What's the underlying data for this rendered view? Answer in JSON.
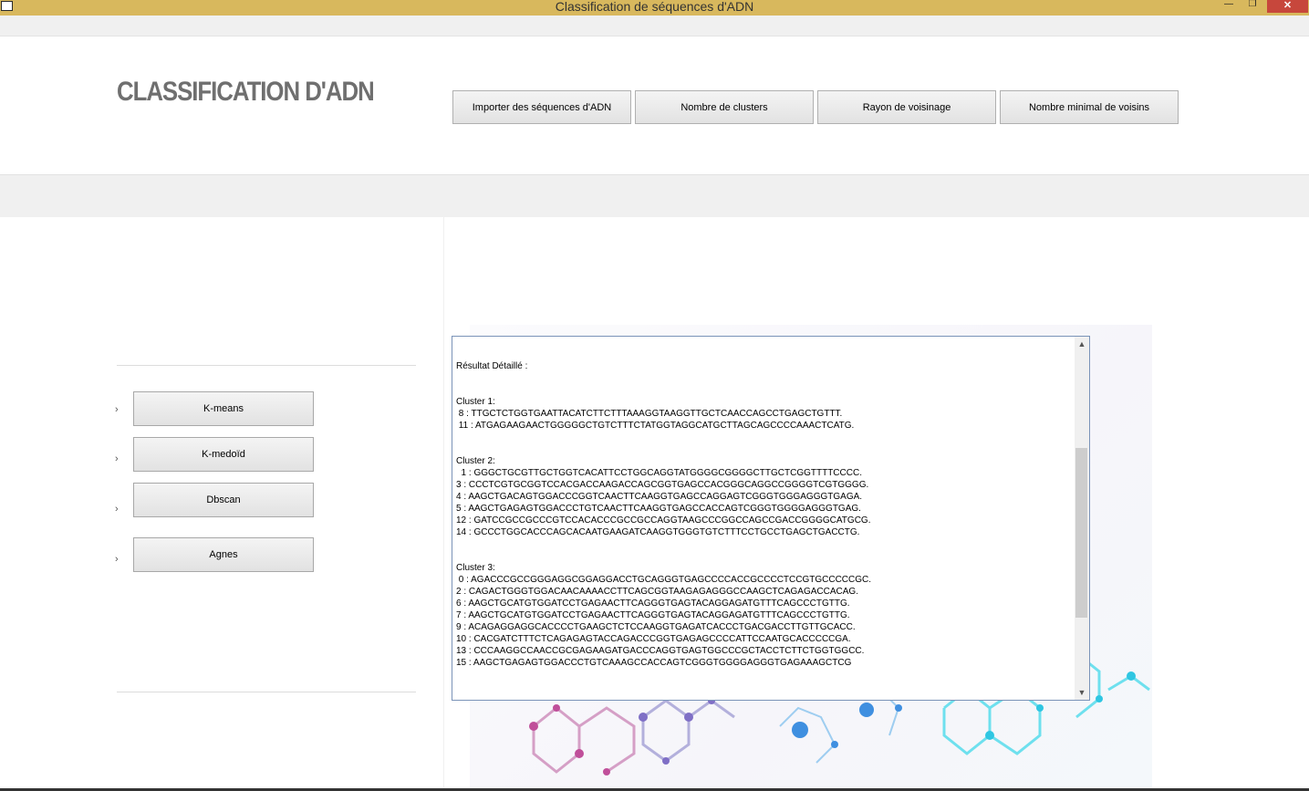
{
  "window": {
    "title": "Classification de séquences d'ADN",
    "min_glyph": "—",
    "max_glyph": "❐",
    "close_glyph": "✕"
  },
  "header": {
    "app_title": "CLASSIFICATION D'ADN",
    "buttons": [
      "Importer des séquences d'ADN",
      "Nombre de clusters",
      "Rayon de voisinage",
      "Nombre minimal de voisins"
    ]
  },
  "sidebar": {
    "chevron": "›",
    "algorithms": [
      "K-means",
      "K-medoïd",
      "Dbscan",
      "Agnes"
    ]
  },
  "result": {
    "lines": [
      "Résultat Détaillé :",
      "",
      "",
      "Cluster 1:",
      " 8 : TTGCTCTGGTGAATTACATCTTCTTTAAAGGTAAGGTTGCTCAACCAGCCTGAGCTGTTT.",
      " 11 : ATGAGAAGAACTGGGGGCTGTCTTTCTATGGTAGGCATGCTTAGCAGCCCCAAACTCATG.",
      "",
      "",
      "Cluster 2:",
      "  1 : GGGCTGCGTTGCTGGTCACATTCCTGGCAGGTATGGGGCGGGGCTTGCTCGGTTTTCCCC.",
      "3 : CCCTCGTGCGGTCCACGACCAAGACCAGCGGTGAGCCACGGGCAGGCCGGGGTCGTGGGG.",
      "4 : AAGCTGACAGTGGACCCGGTCAACTTCAAGGTGAGCCAGGAGTCGGGTGGGAGGGTGAGA.",
      "5 : AAGCTGAGAGTGGACCCTGTCAACTTCAAGGTGAGCCACCAGTCGGGTGGGGAGGGTGAG.",
      "12 : GATCCGCCGCCCGTCCACACCCGCCGCCAGGTAAGCCCGGCCAGCCGACCGGGGCATGCG.",
      "14 : GCCCTGGCACCCAGCACAATGAAGATCAAGGTGGGTGTCTTTCCTGCCTGAGCTGACCTG.",
      "",
      "",
      "Cluster 3:",
      " 0 : AGACCCGCCGGGAGGCGGAGGACCTGCAGGGTGAGCCCCACCGCCCCTCCGTGCCCCCGC.",
      "2 : CAGACTGGGTGGACAACAAAACCTTCAGCGGTAAGAGAGGGCCAAGCTCAGAGACCACAG.",
      "6 : AAGCTGCATGTGGATCCTGAGAACTTCAGGGTGAGTACAGGAGATGTTTCAGCCCTGTTG.",
      "7 : AAGCTGCATGTGGATCCTGAGAACTTCAGGGTGAGTACAGGAGATGTTTCAGCCCTGTTG.",
      "9 : ACAGAGGAGGCACCCCTGAAGCTCTCCAAGGTGAGATCACCCTGACGACCTTGTTGCACC.",
      "10 : CACGATCTTTCTCAGAGAGTACCAGACCCGGTGAGAGCCCCATTCCAATGCACCCCCGA.",
      "13 : CCCAAGGCCAACCGCGAGAAGATGACCCAGGTGAGTGGCCCGCTACCTCTTCTGGTGGCC.",
      "15 : AAGCTGAGAGTGGACCCTGTCAAAGCCACCAGTCGGGTGGGGAGGGTGAGAAAGCTCG"
    ],
    "scroll_up": "▲",
    "scroll_down": "▼"
  }
}
